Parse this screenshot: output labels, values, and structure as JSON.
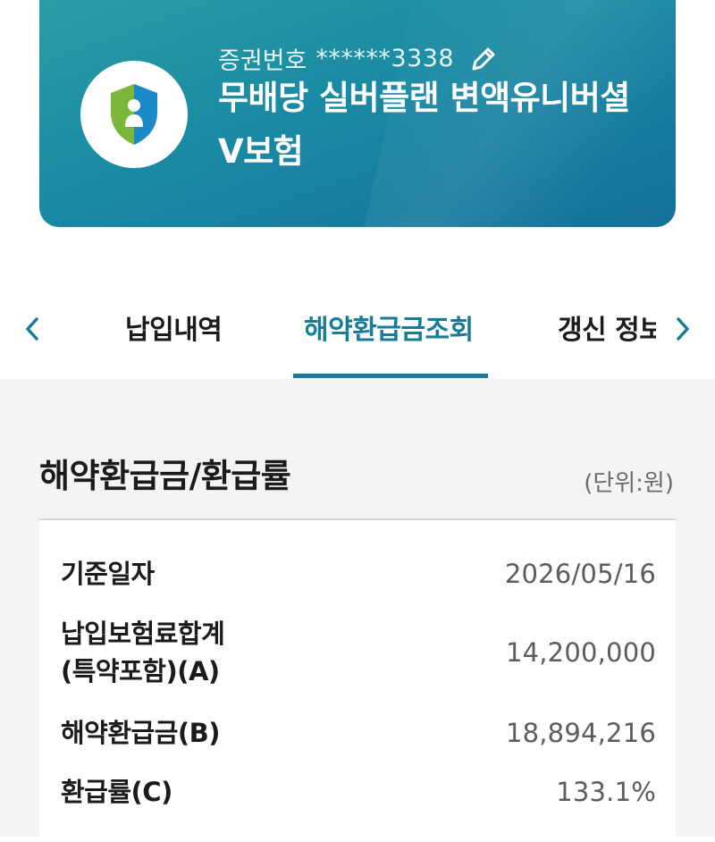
{
  "policy": {
    "number_label": "증권번호",
    "number_value": "******3338",
    "title": "무배당 실버플랜 변액유니버셜V보험",
    "icon": "shield-person-icon",
    "edit_icon": "pencil-icon"
  },
  "tabs": {
    "items": [
      {
        "label": "납입내역"
      },
      {
        "label": "해약환급금조회"
      },
      {
        "label": "갱신 정보"
      }
    ],
    "active_color": "#167c97"
  },
  "section": {
    "title": "해약환급금/환급률",
    "unit": "(단위:원)"
  },
  "table": {
    "rows": [
      {
        "label": "기준일자",
        "value": "2026/05/16"
      },
      {
        "label": "납입보험료합계\n(특약포함)(A)",
        "value": "14,200,000"
      },
      {
        "label": "해약환급금(B)",
        "value": "18,894,216"
      },
      {
        "label": "환급률(C)",
        "value": "133.1%"
      }
    ]
  },
  "colors": {
    "card_gradient_start": "#2b9fa4",
    "card_gradient_end": "#14709a",
    "shield_green": "#7ab83b",
    "shield_blue": "#1d8ac8"
  }
}
